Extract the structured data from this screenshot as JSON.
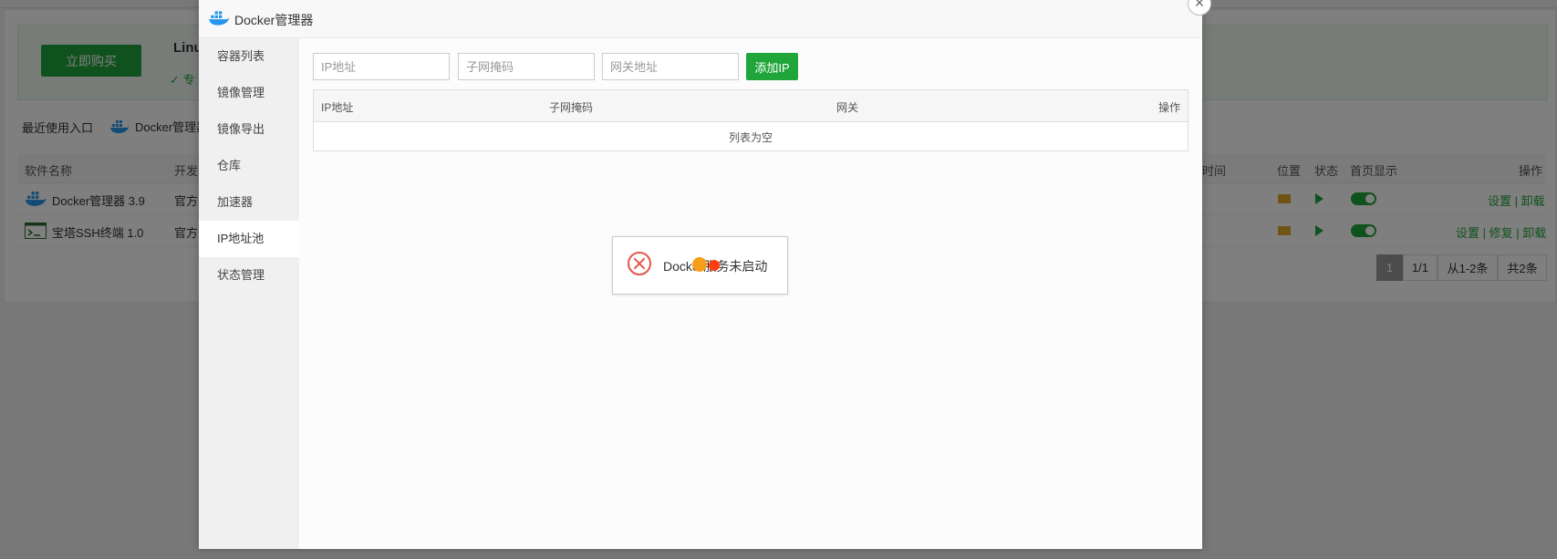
{
  "background": {
    "buy_button": "立即购买",
    "banner_title": "Linu",
    "banner_check": "✓ 专",
    "recent_label": "最近使用入口",
    "recent_docker": "Docker管理器",
    "table_headers": [
      "软件名称",
      "开发商",
      "时间",
      "位置",
      "状态",
      "首页显示",
      "操作"
    ],
    "rows": [
      {
        "name": "Docker管理器 3.9",
        "dev": "官方",
        "actions": "设置 | 卸载"
      },
      {
        "name": "宝塔SSH终端 1.0",
        "dev": "官方",
        "actions": "设置 | 修复 | 卸载"
      }
    ],
    "pager": {
      "current": "1",
      "pages": "1/1",
      "range": "从1-2条",
      "total": "共2条"
    }
  },
  "modal": {
    "title": "Docker管理器",
    "close_label": "×",
    "sidebar": [
      "容器列表",
      "镜像管理",
      "镜像导出",
      "仓库",
      "加速器",
      "IP地址池",
      "状态管理"
    ],
    "active_sidebar": "IP地址池",
    "form": {
      "ip_placeholder": "IP地址",
      "mask_placeholder": "子网掩码",
      "gateway_placeholder": "网关地址",
      "add_button": "添加IP"
    },
    "table": {
      "headers": [
        "IP地址",
        "子网掩码",
        "网关",
        "操作"
      ],
      "empty_text": "列表为空"
    }
  },
  "toast": {
    "message": "Docker服务未启动",
    "icon": "error-icon"
  },
  "colors": {
    "accent": "#20a53a",
    "error": "#e5554a",
    "docker_blue": "#2496ed"
  }
}
